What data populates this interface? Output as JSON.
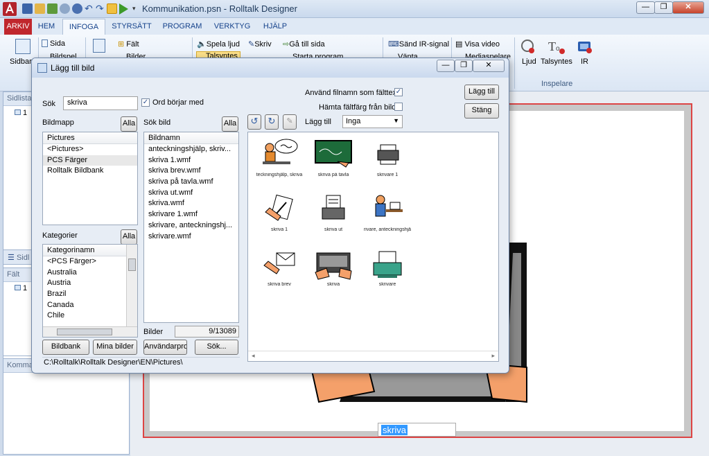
{
  "app": {
    "title": "Kommunikation.psn - Rolltalk Designer"
  },
  "menu": {
    "tabs": [
      "ARKIV",
      "HEM",
      "INFOGA",
      "STYRSÄTT",
      "PROGRAM",
      "VERKTYG",
      "HJÄLP"
    ]
  },
  "ribbon": {
    "sida": "Sida",
    "bildspel": "Bildspel",
    "falt": "Fält",
    "bilder": "Bilder",
    "spela_ljud": "Spela ljud",
    "talsyntes_sm": "Talsyntes",
    "skriv": "Skriv",
    "ga_till_sida": "Gå till sida",
    "starta_program": "Starta program",
    "sand_ir": "Sänd IR-signal",
    "vanta": "Vänta",
    "visa_video": "Visa video",
    "mediaspelare": "Mediaspelare",
    "ljud": "Ljud",
    "talsyntes": "Talsyntes",
    "ir": "IR",
    "group_inspelare": "Inspelare"
  },
  "left": {
    "sidlista": "Sidlista",
    "item1": "1",
    "sidlayout": "Sidl",
    "falt": "Fält",
    "item2": "1",
    "kommando": "Komma"
  },
  "canvas": {
    "field_text": "skriva"
  },
  "dialog": {
    "title": "Lägg till bild",
    "sok_label": "Sök",
    "sok_value": "skriva",
    "ord_borjar_med": "Ord börjar med",
    "anvand_filnamn": "Använd filnamn som fälttext",
    "hamta_faltfarg": "Hämta fältfärg från bild",
    "lagg_till_label": "Lägg till",
    "lagg_till_select": "Inga",
    "btn_lagg_till": "Lägg till",
    "btn_stang": "Stäng",
    "bildmapp": "Bildmapp",
    "alla": "Alla",
    "sok_bild": "Sök bild",
    "pictures_header": "Pictures",
    "pictures": [
      "<Pictures>",
      "PCS Färger",
      "Rolltalk Bildbank"
    ],
    "kategorier": "Kategorier",
    "kategorinamn": "Kategorinamn",
    "kategori_items": [
      "<PCS Färger>",
      "Australia",
      "Austria",
      "Brazil",
      "Canada",
      "Chile"
    ],
    "bildnamn_header": "Bildnamn",
    "bildnamn": [
      "anteckningshjälp, skriv...",
      "skriva 1.wmf",
      "skriva brev.wmf",
      "skriva på tavla.wmf",
      "skriva ut.wmf",
      "skriva.wmf",
      "skrivare 1.wmf",
      "skrivare, anteckningshj...",
      "skrivare.wmf"
    ],
    "bilder_label": "Bilder",
    "bilder_count": "9/13089",
    "btn_bildbank": "Bildbank",
    "btn_mina_bilder": "Mina bilder",
    "btn_anvandarproc": "Användarproc",
    "btn_sok": "Sök...",
    "path": "C:\\Rolltalk\\Rolltalk Designer\\EN\\Pictures\\",
    "thumbs": [
      {
        "caption": "teckningshjälp, skriva",
        "icon": "person-writing-speech-icon"
      },
      {
        "caption": "skriva på tavla",
        "icon": "chalkboard-icon"
      },
      {
        "caption": "skrivare 1",
        "icon": "printer-icon"
      },
      {
        "caption": "skriva 1",
        "icon": "hand-pen-icon"
      },
      {
        "caption": "skriva ut",
        "icon": "printer-out-icon"
      },
      {
        "caption": "rivare, anteckningshjä",
        "icon": "person-desk-icon"
      },
      {
        "caption": "skriva brev",
        "icon": "hand-letter-icon"
      },
      {
        "caption": "skriva",
        "icon": "keyboard-icon"
      },
      {
        "caption": "skrivare",
        "icon": "green-printer-icon"
      }
    ]
  }
}
